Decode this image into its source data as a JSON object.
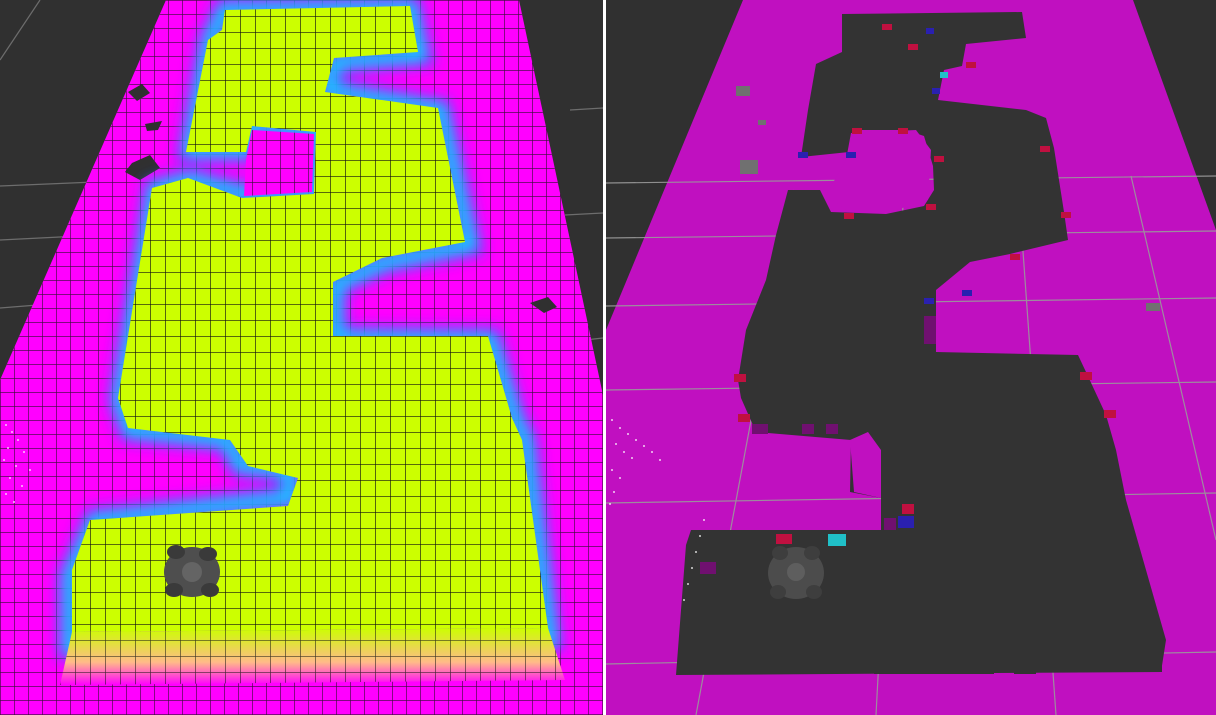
{
  "views": [
    {
      "id": "elevation-grid-view",
      "render": "3d-elevation-grid",
      "colors": {
        "background": "#303030",
        "grid_lines": "#7a7a7a",
        "low_surface": "#ff00ff",
        "high_surface": "#ccff00",
        "transition": [
          "#ff00ff",
          "#2b4dff",
          "#22d3ff",
          "#44ff88",
          "#ccff00"
        ],
        "cell_outline": "#111111",
        "robot": "#555555"
      },
      "icons": [
        "robot-model-icon"
      ]
    },
    {
      "id": "costmap-view",
      "render": "2d-occupancy-costmap",
      "colors": {
        "background": "#303030",
        "grid_lines": "#8a8a8a",
        "lethal": "#c010c0",
        "free": "#333333",
        "inflated": "#c01040",
        "inscribed": "#2a20b0",
        "unknown": "#20c0c8",
        "robot": "#555555"
      },
      "icons": [
        "robot-model-icon",
        "laser-scan-points-icon"
      ]
    }
  ],
  "divider_color": "#ffffff"
}
